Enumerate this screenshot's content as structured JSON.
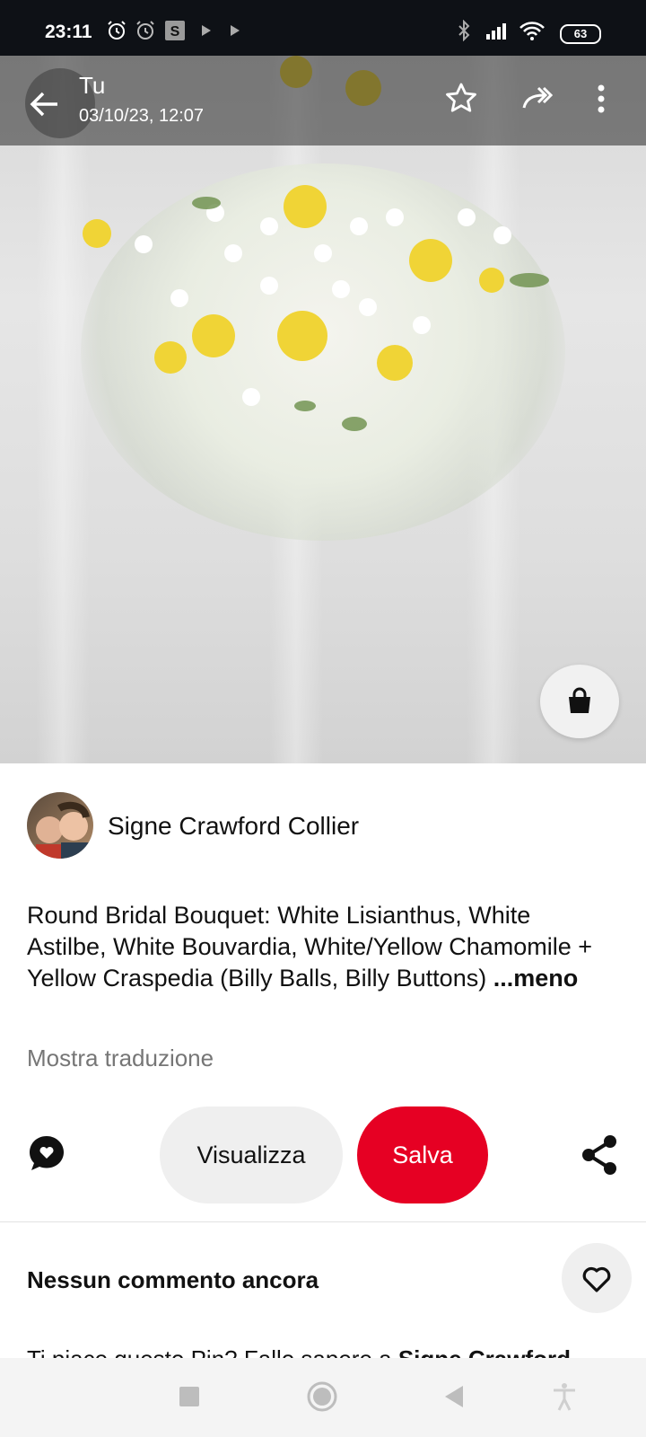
{
  "status_bar": {
    "time": "23:11",
    "battery": "63",
    "icons": [
      "alarm-icon",
      "alarm-off-icon",
      "s-app-icon",
      "play-icon",
      "play-icon",
      "bluetooth-icon",
      "signal-icon",
      "wifi-icon",
      "battery-icon"
    ]
  },
  "header": {
    "owner": "Tu",
    "timestamp": "03/10/23, 12:07",
    "icons": [
      "back-arrow-icon",
      "star-icon",
      "forward-icon",
      "more-vertical-icon"
    ]
  },
  "image": {
    "subject": "bridal-bouquet",
    "shop_icon": "shopping-bag-icon"
  },
  "pin": {
    "author": "Signe Crawford Collier",
    "description": "Round Bridal Bouquet: White Lisianthus, White Astilbe, White Bouvardia, White/Yellow Chamomile + Yellow Craspedia (Billy Balls, Billy Buttons)",
    "more_label": " ...meno",
    "translate_label": "Mostra traduzione"
  },
  "actions": {
    "view_label": "Visualizza",
    "save_label": "Salva",
    "save_color": "#e60023"
  },
  "comments": {
    "title": "Nessun commento ancora",
    "prompt": "Ti piace questo Pin? Fallo sapere a ",
    "prompt_name": "Signe Crawford"
  },
  "nav": {
    "icons": [
      "recents-square-icon",
      "home-circle-icon",
      "back-triangle-icon",
      "accessibility-icon"
    ]
  }
}
